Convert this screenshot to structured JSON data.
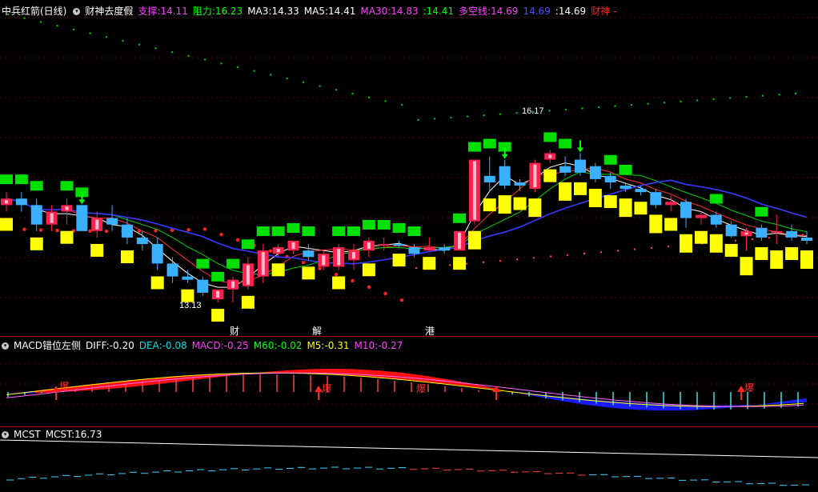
{
  "main_panel": {
    "title": "中兵红箭(日线)",
    "indicator_name": "财神去度假",
    "items": [
      {
        "label": "支撑:",
        "value": "14.11",
        "color": "#ff3cff"
      },
      {
        "label": "阻力:",
        "value": "16.23",
        "color": "#00ff00"
      },
      {
        "label": "MA3:",
        "value": "14.33",
        "color": "#ffffff"
      },
      {
        "label": "MA5:",
        "value": "14.41",
        "color": "#ffffff"
      },
      {
        "label": "MA30:",
        "value": "14.83",
        "color": "#ff3cff"
      },
      {
        "label": ":",
        "value": "14.41",
        "color": "#00ff00"
      },
      {
        "label": "多空线:",
        "value": "14.69",
        "color": "#ff3cff"
      },
      {
        "label": "",
        "value": "14.69",
        "color": "#4a4aff"
      },
      {
        "label": ":",
        "value": "14.69",
        "color": "#ffffff"
      },
      {
        "label": "财神",
        "value": "-",
        "color": "#ff2020"
      }
    ],
    "high_label": "16.17",
    "low_label": "13.13",
    "bottom_tags": [
      {
        "text": "财",
        "color": "#ffffff"
      },
      {
        "text": "解",
        "color": "#ffffff"
      },
      {
        "text": "港",
        "color": "#ffffff"
      }
    ]
  },
  "macd_panel": {
    "title": "MACD错位左侧",
    "items": [
      {
        "label": "DIFF:",
        "value": "-0.20",
        "color": "#ffffff"
      },
      {
        "label": "DEA:",
        "value": "-0.08",
        "color": "#00e0e0"
      },
      {
        "label": "MACD:",
        "value": "-0.25",
        "color": "#ff3cff"
      },
      {
        "label": "M60:",
        "value": "-0.02",
        "color": "#00ff00"
      },
      {
        "label": "M5:",
        "value": "-0.31",
        "color": "#ffff00"
      },
      {
        "label": "M10:",
        "value": "-0.27",
        "color": "#ff3cff"
      }
    ],
    "signal_text": "爆"
  },
  "mcst_panel": {
    "title": "MCST",
    "items": [
      {
        "label": "MCST:",
        "value": "16.73",
        "color": "#ffffff"
      }
    ]
  },
  "chart_data": {
    "type": "candlestick",
    "candles": [
      [
        14.6,
        14.8,
        14.5,
        14.7
      ],
      [
        14.7,
        14.8,
        14.5,
        14.6
      ],
      [
        14.6,
        14.7,
        14.2,
        14.3
      ],
      [
        14.3,
        14.6,
        14.2,
        14.5
      ],
      [
        14.5,
        14.7,
        14.3,
        14.6
      ],
      [
        14.6,
        14.6,
        14.2,
        14.2
      ],
      [
        14.2,
        14.5,
        14.1,
        14.4
      ],
      [
        14.4,
        14.6,
        14.2,
        14.3
      ],
      [
        14.3,
        14.4,
        14.0,
        14.1
      ],
      [
        14.1,
        14.2,
        13.9,
        14.0
      ],
      [
        14.0,
        14.1,
        13.6,
        13.7
      ],
      [
        13.7,
        13.8,
        13.4,
        13.5
      ],
      [
        13.5,
        13.6,
        13.4,
        13.45
      ],
      [
        13.45,
        13.5,
        13.2,
        13.25
      ],
      [
        13.15,
        13.3,
        13.1,
        13.3
      ],
      [
        13.3,
        13.5,
        13.1,
        13.45
      ],
      [
        13.35,
        13.8,
        13.3,
        13.7
      ],
      [
        13.5,
        14.0,
        13.4,
        13.9
      ],
      [
        13.85,
        14.0,
        13.8,
        13.95
      ],
      [
        13.9,
        14.05,
        13.85,
        14.05
      ],
      [
        13.9,
        14.0,
        13.75,
        13.8
      ],
      [
        13.65,
        13.9,
        13.6,
        13.85
      ],
      [
        13.65,
        14.0,
        13.6,
        13.95
      ],
      [
        13.75,
        14.0,
        13.6,
        13.9
      ],
      [
        13.9,
        14.1,
        13.8,
        14.05
      ],
      [
        14.0,
        14.1,
        13.9,
        14.0
      ],
      [
        14.0,
        14.05,
        13.95,
        13.98
      ],
      [
        13.95,
        14.0,
        13.8,
        13.85
      ],
      [
        13.9,
        14.1,
        13.9,
        13.95
      ],
      [
        13.95,
        14.0,
        13.85,
        13.9
      ],
      [
        13.9,
        14.2,
        13.9,
        14.2
      ],
      [
        14.35,
        15.3,
        14.3,
        15.3
      ],
      [
        15.05,
        15.35,
        14.8,
        14.95
      ],
      [
        15.2,
        15.3,
        14.85,
        14.9
      ],
      [
        14.95,
        15.0,
        14.82,
        14.9
      ],
      [
        14.85,
        15.3,
        14.8,
        15.25
      ],
      [
        15.3,
        15.45,
        15.25,
        15.4
      ],
      [
        15.2,
        15.35,
        15.05,
        15.1
      ],
      [
        15.3,
        15.4,
        15.05,
        15.1
      ],
      [
        15.2,
        15.25,
        14.95,
        15.0
      ],
      [
        15.05,
        15.1,
        14.85,
        14.95
      ],
      [
        14.9,
        14.95,
        14.8,
        14.85
      ],
      [
        14.85,
        14.9,
        14.75,
        14.8
      ],
      [
        14.8,
        14.85,
        14.55,
        14.6
      ],
      [
        14.6,
        14.75,
        14.5,
        14.65
      ],
      [
        14.65,
        14.7,
        14.25,
        14.4
      ],
      [
        14.4,
        14.5,
        14.3,
        14.45
      ],
      [
        14.45,
        14.5,
        14.25,
        14.3
      ],
      [
        14.3,
        14.35,
        14.1,
        14.12
      ],
      [
        14.12,
        14.25,
        13.9,
        14.2
      ],
      [
        14.25,
        14.3,
        14.05,
        14.1
      ],
      [
        14.2,
        14.45,
        14.0,
        14.2
      ],
      [
        14.2,
        14.3,
        14.05,
        14.1
      ],
      [
        14.1,
        14.2,
        14.0,
        14.05
      ]
    ]
  }
}
